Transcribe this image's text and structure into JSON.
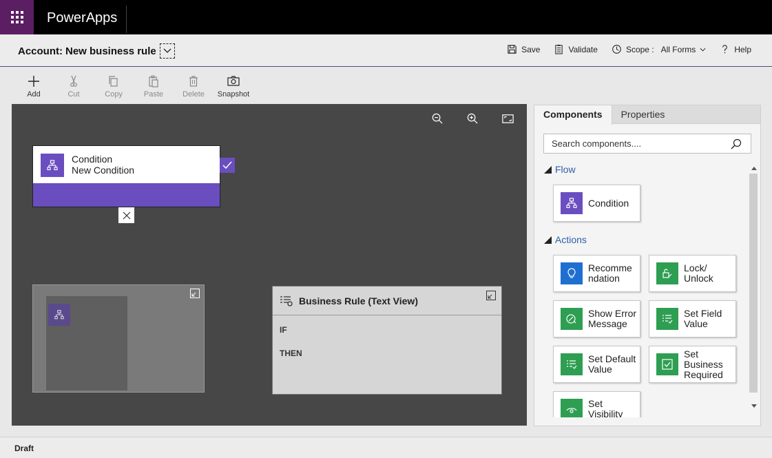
{
  "app": {
    "name": "PowerApps"
  },
  "header": {
    "entity": "Account:",
    "rule_name": "New business rule",
    "actions": {
      "save": "Save",
      "validate": "Validate",
      "scope_label": "Scope :",
      "scope_value": "All Forms",
      "help": "Help"
    }
  },
  "toolbar": {
    "add": "Add",
    "cut": "Cut",
    "copy": "Copy",
    "paste": "Paste",
    "delete": "Delete",
    "snapshot": "Snapshot"
  },
  "canvas": {
    "condition": {
      "type": "Condition",
      "name": "New Condition"
    },
    "text_view": {
      "title": "Business Rule (Text View)",
      "if_label": "IF",
      "then_label": "THEN"
    }
  },
  "panel": {
    "tabs": [
      "Components",
      "Properties"
    ],
    "search_placeholder": "Search components....",
    "sections": {
      "flow": {
        "title": "Flow",
        "items": [
          "Condition"
        ]
      },
      "actions": {
        "title": "Actions",
        "items": [
          "Recomme ndation",
          "Lock/ Unlock",
          "Show Error Message",
          "Set Field Value",
          "Set Default Value",
          "Set Business Required",
          "Set Visibility"
        ]
      }
    }
  },
  "status": {
    "text": "Draft"
  },
  "colors": {
    "accent_purple": "#6a4ec0",
    "waffle": "#5c1e63",
    "blue": "#1f6fd1",
    "green": "#2e9e52"
  }
}
